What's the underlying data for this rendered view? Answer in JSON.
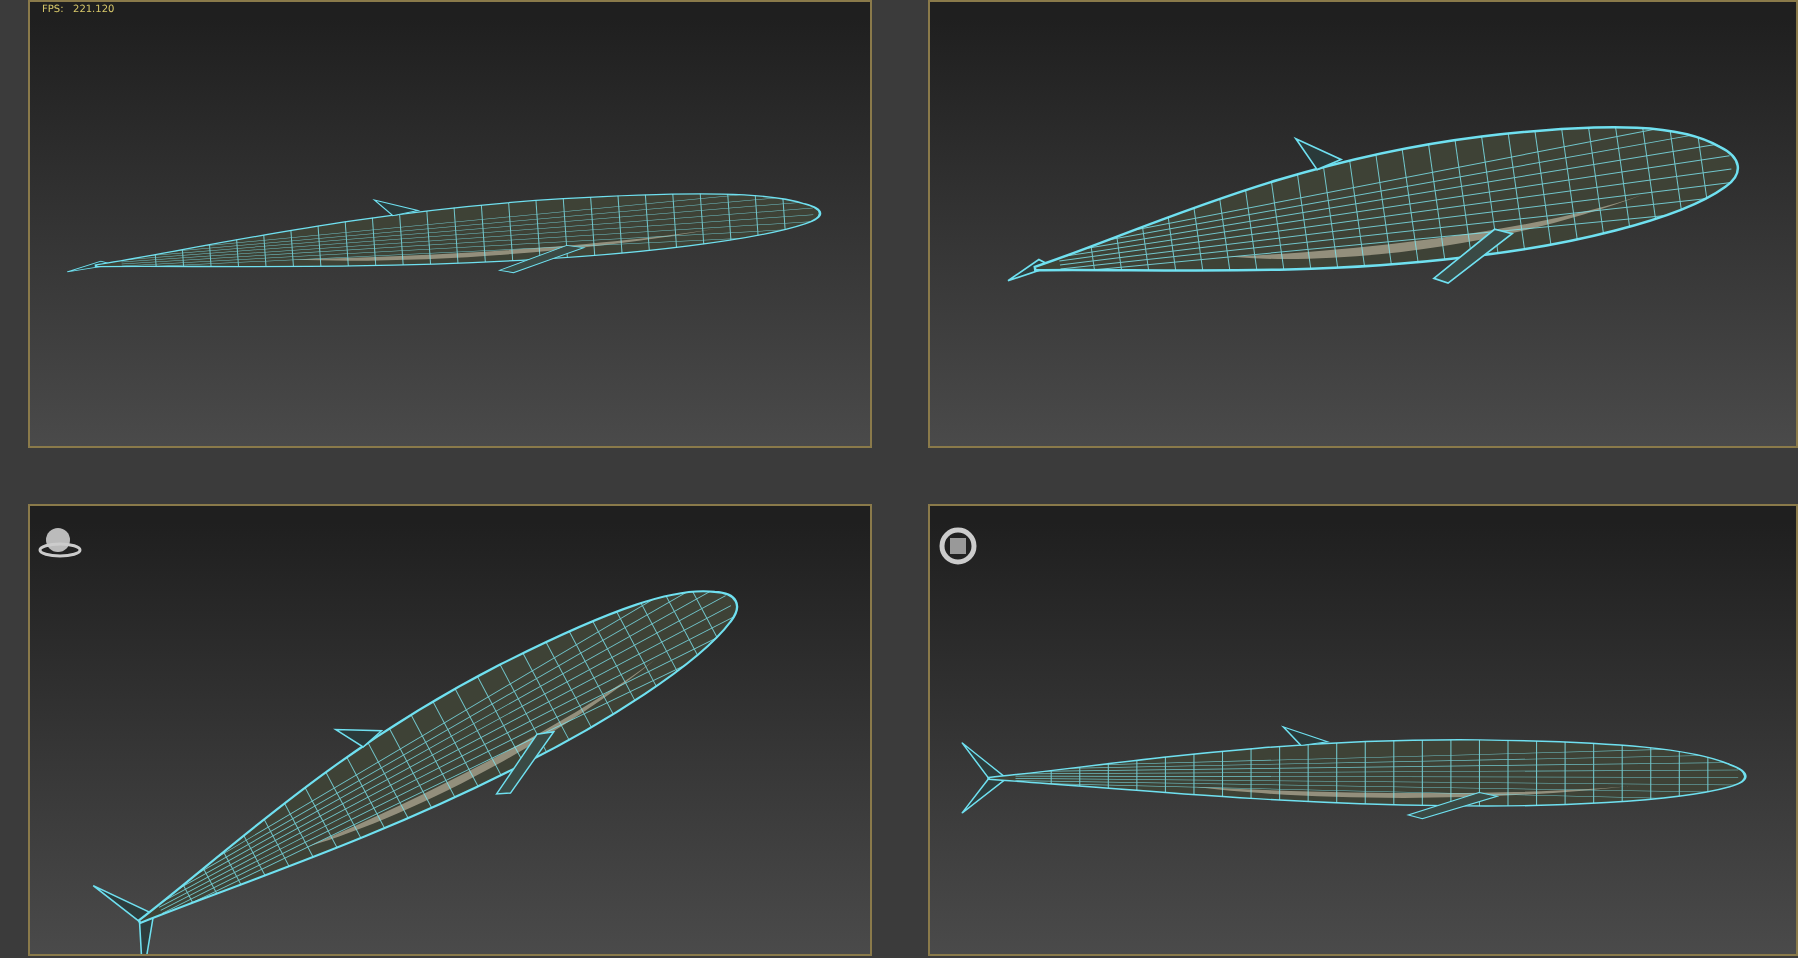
{
  "viewports": [
    {
      "kind": "side",
      "stats": "FPS:   221.120"
    },
    {
      "kind": "perspective"
    },
    {
      "kind": "diagonal",
      "gizmo": {
        "kind": "sphere"
      }
    },
    {
      "kind": "top",
      "gizmo": {
        "kind": "ring"
      }
    }
  ]
}
